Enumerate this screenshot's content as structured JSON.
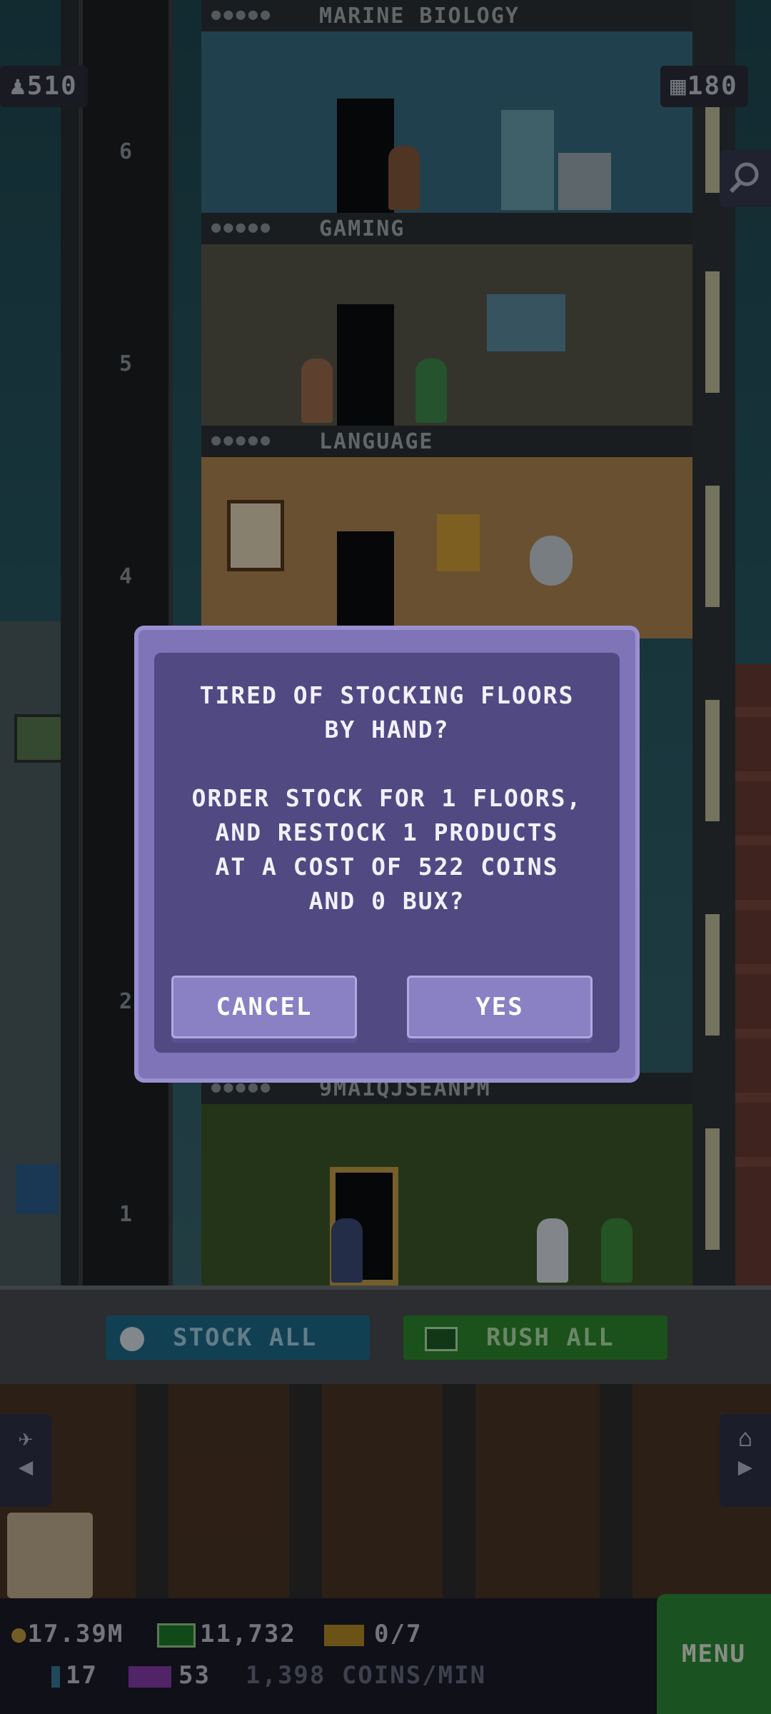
{
  "hud": {
    "population": "510",
    "floors_count": "180"
  },
  "floors": [
    {
      "number": "6",
      "name": "MARINE BIOLOGY",
      "color": "#3a6f86"
    },
    {
      "number": "5",
      "name": "GAMING",
      "color": "#5a5a4e"
    },
    {
      "number": "4",
      "name": "LANGUAGE",
      "color": "#b58a55"
    },
    {
      "number": "1",
      "name": "9MA1QJSEANPM",
      "color": "#3f5a2a"
    }
  ],
  "elevator_numbers": [
    "6",
    "5",
    "4",
    "2",
    "1"
  ],
  "dialog": {
    "line1": "TIRED OF STOCKING FLOORS",
    "line2": "BY HAND?",
    "line3": "ORDER STOCK FOR 1 FLOORS,",
    "line4": "AND RESTOCK 1 PRODUCTS",
    "line5": "AT A COST OF 522 COINS",
    "line6": "AND 0 BUX?",
    "cancel_label": "CANCEL",
    "yes_label": "YES"
  },
  "toolbar": {
    "stock_all_label": "STOCK ALL",
    "rush_all_label": "RUSH ALL"
  },
  "status": {
    "coins": "17.39M",
    "bux": "11,732",
    "tickets": "0/7",
    "vip": "17",
    "tv": "53",
    "rate": "1,398 COINS/MIN",
    "menu_label": "MENU"
  },
  "colors": {
    "dialog_outer": "#7f74b8",
    "dialog_inner": "#514982",
    "stock_btn": "#1f6f8f",
    "rush_btn": "#2f8d2f",
    "menu_btn": "#2f8d39"
  }
}
